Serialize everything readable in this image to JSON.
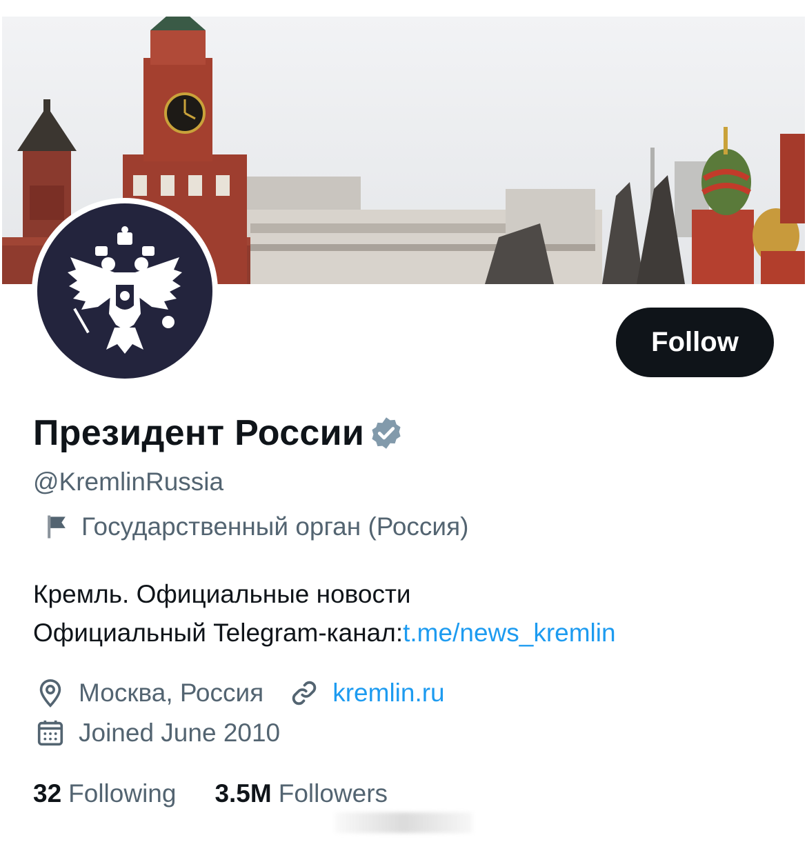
{
  "profile": {
    "display_name": "Президент России",
    "handle": "@KremlinRussia",
    "follow_label": "Follow",
    "affiliation": "Государственный орган (Россия)",
    "bio_line1": "Кремль. Официальные новости",
    "bio_line2_prefix": "Официальный Telegram-канал:",
    "bio_link": "t.me/news_kremlin",
    "location": "Москва, Россия",
    "website": "kremlin.ru",
    "joined": "Joined June 2010",
    "following_count": "32",
    "following_label": "Following",
    "followers_count": "3.5M",
    "followers_label": "Followers"
  },
  "icons": {
    "verified": "verified-badge-icon",
    "affiliation": "flag-icon",
    "location": "location-pin-icon",
    "website": "link-icon",
    "joined": "calendar-icon"
  },
  "colors": {
    "primary_text": "#0f1419",
    "secondary_text": "#536471",
    "link": "#1d9bf0",
    "follow_button_bg": "#0f1419",
    "verified_badge": "#829aab",
    "avatar_bg": "#23243d"
  }
}
